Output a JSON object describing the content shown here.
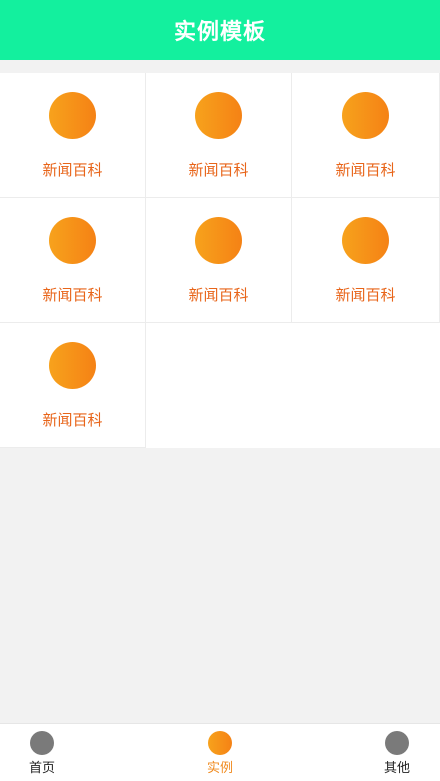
{
  "header": {
    "title": "实例模板"
  },
  "accent_color": "#13f09e",
  "icon_gradient": [
    "#f7a21c",
    "#f58215"
  ],
  "grid": {
    "items": [
      {
        "label": "新闻百科",
        "icon": "orange-circle-icon"
      },
      {
        "label": "新闻百科",
        "icon": "orange-circle-icon"
      },
      {
        "label": "新闻百科",
        "icon": "orange-circle-icon"
      },
      {
        "label": "新闻百科",
        "icon": "orange-circle-icon"
      },
      {
        "label": "新闻百科",
        "icon": "orange-circle-icon"
      },
      {
        "label": "新闻百科",
        "icon": "orange-circle-icon"
      },
      {
        "label": "新闻百科",
        "icon": "orange-circle-icon"
      }
    ]
  },
  "tabbar": {
    "tabs": [
      {
        "label": "首页",
        "icon": "home-icon",
        "active": false
      },
      {
        "label": "实例",
        "icon": "example-icon",
        "active": true
      },
      {
        "label": "其他",
        "icon": "other-icon",
        "active": false
      }
    ]
  }
}
